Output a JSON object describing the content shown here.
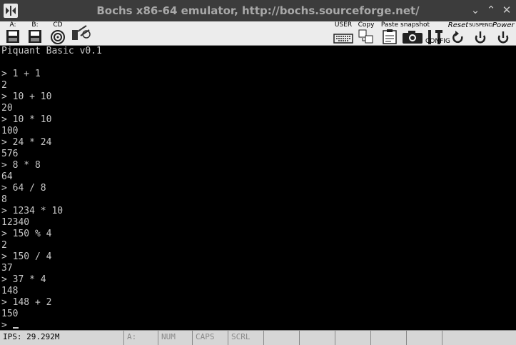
{
  "window": {
    "title": "Bochs x86-64 emulator, http://bochs.sourceforge.net/",
    "minimize_glyph": "⌄",
    "maximize_glyph": "⌃",
    "close_glyph": "✕"
  },
  "toolbar": {
    "floppy_a_label": "A:",
    "floppy_b_label": "B:",
    "cdrom_label": "CD",
    "user_label": "USER",
    "copy_label": "Copy",
    "paste_label": "Paste",
    "snapshot_label": "snapshot",
    "config_label": "CONFIG",
    "reset_label": "Reset",
    "suspend_label": "SUSPEND",
    "power_label": "Power"
  },
  "console": {
    "lines": [
      "Piquant Basic v0.1",
      "",
      "> 1 + 1",
      "2",
      "> 10 + 10",
      "20",
      "> 10 * 10",
      "100",
      "> 24 * 24",
      "576",
      "> 8 * 8",
      "64",
      "> 64 / 8",
      "8",
      "> 1234 * 10",
      "12340",
      "> 150 % 4",
      "2",
      "> 150 / 4",
      "37",
      "> 37 * 4",
      "148",
      "> 148 + 2",
      "150"
    ],
    "prompt": "> "
  },
  "status": {
    "ips": "IPS: 29.292M",
    "drive": "A:",
    "num": "NUM",
    "caps": "CAPS",
    "scrl": "SCRL"
  },
  "colors": {
    "titlebar": "#3c3c3c",
    "toolbar": "#ececec",
    "screen": "#000000",
    "console_text": "#c8c8c8",
    "statusbar": "#d6d6d6"
  }
}
